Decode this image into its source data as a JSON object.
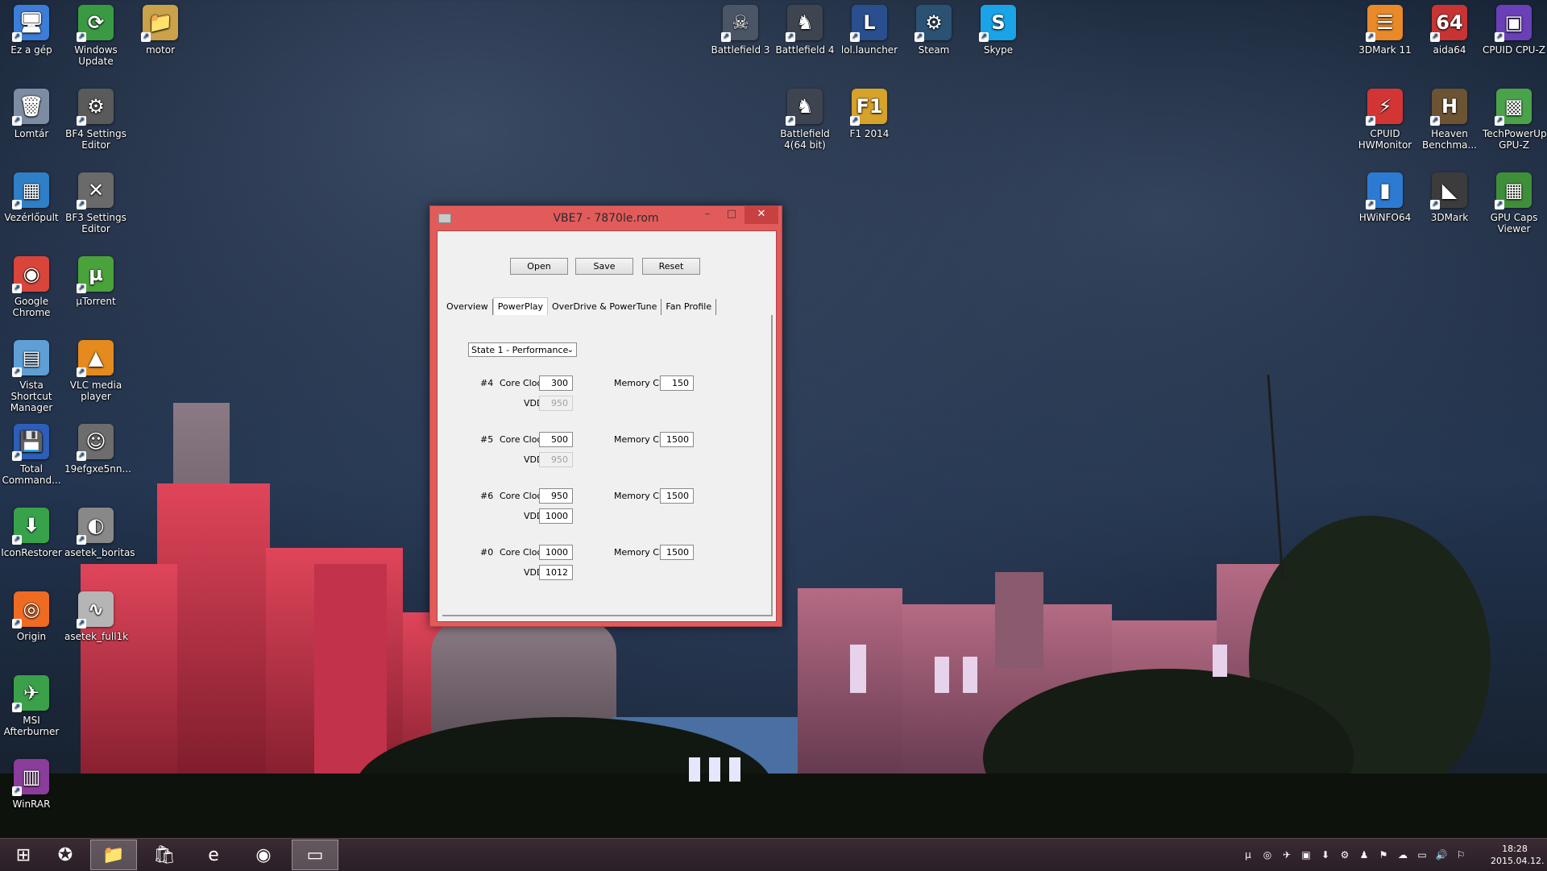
{
  "desktop_icons": [
    {
      "label": "Ez a gép",
      "icon": "computer-icon",
      "color": "#3b7dd8",
      "glyph": "🖥"
    },
    {
      "label": "Windows Update",
      "icon": "windows-update-icon",
      "color": "#3a9a43",
      "glyph": "⟳"
    },
    {
      "label": "motor",
      "icon": "folder-icon",
      "color": "#c9a24a",
      "glyph": "📁"
    },
    {
      "label": "Lomtár",
      "icon": "recycle-bin-icon",
      "color": "#7c8da3",
      "glyph": "🗑"
    },
    {
      "label": "BF4 Settings Editor",
      "icon": "gear-icon",
      "color": "#5a5a5a",
      "glyph": "⚙"
    },
    {
      "label": "Vezérlőpult",
      "icon": "control-panel-icon",
      "color": "#2f7fc7",
      "glyph": "▦"
    },
    {
      "label": "BF3 Settings Editor",
      "icon": "tools-icon",
      "color": "#6a6a6a",
      "glyph": "✕"
    },
    {
      "label": "Google Chrome",
      "icon": "chrome-icon",
      "color": "#d9453b",
      "glyph": "◉"
    },
    {
      "label": "µTorrent",
      "icon": "utorrent-icon",
      "color": "#4aa23a",
      "glyph": "µ"
    },
    {
      "label": "Vista Shortcut Manager",
      "icon": "shortcut-manager-icon",
      "color": "#5f9fd6",
      "glyph": "▤"
    },
    {
      "label": "VLC media player",
      "icon": "vlc-icon",
      "color": "#e58a1f",
      "glyph": "▲"
    },
    {
      "label": "Total Command...",
      "icon": "total-commander-icon",
      "color": "#2d5fb8",
      "glyph": "💾"
    },
    {
      "label": "19efgxe5nn...",
      "icon": "image-file-icon",
      "color": "#6d6d6d",
      "glyph": "☺"
    },
    {
      "label": "IconRestorer",
      "icon": "icon-restorer-icon",
      "color": "#38a24b",
      "glyph": "⬇"
    },
    {
      "label": "asetek_boritas",
      "icon": "image-file-icon",
      "color": "#888888",
      "glyph": "◐"
    },
    {
      "label": "Origin",
      "icon": "origin-icon",
      "color": "#f06b22",
      "glyph": "◎"
    },
    {
      "label": "asetek_full1k",
      "icon": "image-file-icon",
      "color": "#b5b5b5",
      "glyph": "∿"
    },
    {
      "label": "MSI Afterburner",
      "icon": "msi-afterburner-icon",
      "color": "#3aa04a",
      "glyph": "✈"
    },
    {
      "label": "WinRAR",
      "icon": "winrar-icon",
      "color": "#8a3d9a",
      "glyph": "▥"
    },
    {
      "label": "Battlefield 3",
      "icon": "battlefield3-icon",
      "color": "#4a5566",
      "glyph": "☠"
    },
    {
      "label": "Battlefield 4",
      "icon": "battlefield4-icon",
      "color": "#3f4550",
      "glyph": "♞"
    },
    {
      "label": "lol.launcher",
      "icon": "lol-launcher-icon",
      "color": "#2a4f8f",
      "glyph": "L"
    },
    {
      "label": "Steam",
      "icon": "steam-icon",
      "color": "#2b5273",
      "glyph": "⚙"
    },
    {
      "label": "Skype",
      "icon": "skype-icon",
      "color": "#1aa3e6",
      "glyph": "S"
    },
    {
      "label": "Battlefield 4(64 bit)",
      "icon": "battlefield4-icon",
      "color": "#3f4550",
      "glyph": "♞"
    },
    {
      "label": "F1 2014",
      "icon": "f1-2014-icon",
      "color": "#d6a22a",
      "glyph": "F1"
    },
    {
      "label": "3DMark 11",
      "icon": "3dmark11-icon",
      "color": "#e8892a",
      "glyph": "☰"
    },
    {
      "label": "aida64",
      "icon": "aida64-icon",
      "color": "#c73434",
      "glyph": "64"
    },
    {
      "label": "CPUID CPU-Z",
      "icon": "cpuz-icon",
      "color": "#6a3fb8",
      "glyph": "▣"
    },
    {
      "label": "CPUID HWMonitor",
      "icon": "hwmonitor-icon",
      "color": "#d33535",
      "glyph": "⚡"
    },
    {
      "label": "Heaven Benchma...",
      "icon": "heaven-benchmark-icon",
      "color": "#6b5334",
      "glyph": "H"
    },
    {
      "label": "TechPowerUp GPU-Z",
      "icon": "gpuz-icon",
      "color": "#4aa24a",
      "glyph": "▩"
    },
    {
      "label": "HWiNFO64",
      "icon": "hwinfo-icon",
      "color": "#2d7ad3",
      "glyph": "▮"
    },
    {
      "label": "3DMark",
      "icon": "3dmark-icon",
      "color": "#3c3c3c",
      "glyph": "◣"
    },
    {
      "label": "GPU Caps Viewer",
      "icon": "gpu-caps-icon",
      "color": "#3f8f3a",
      "glyph": "▦"
    }
  ],
  "window": {
    "title": "VBE7 - 7870le.rom",
    "controls": {
      "minimize": "–",
      "maximize": "□",
      "close": "✕"
    },
    "buttons": {
      "open": "Open",
      "save": "Save",
      "reset": "Reset"
    },
    "tabs": [
      "Overview",
      "PowerPlay",
      "OverDrive & PowerTune",
      "Fan Profile"
    ],
    "active_tab": "PowerPlay",
    "state_select": "State 1 - Performance",
    "core_label": "Core Clock",
    "memory_label": "Memory Clock",
    "vddc_label": "VDDC",
    "states": [
      {
        "id": "#4",
        "core": "300",
        "memory": "150",
        "vddc": "950",
        "vddc_disabled": true
      },
      {
        "id": "#5",
        "core": "500",
        "memory": "1500",
        "vddc": "950",
        "vddc_disabled": true
      },
      {
        "id": "#6",
        "core": "950",
        "memory": "1500",
        "vddc": "1000",
        "vddc_disabled": false
      },
      {
        "id": "#0",
        "core": "1000",
        "memory": "1500",
        "vddc": "1012",
        "vddc_disabled": false
      }
    ]
  },
  "taskbar": {
    "items": [
      {
        "name": "start-button",
        "glyph": "⊞"
      },
      {
        "name": "taskbar-app-unknown",
        "glyph": "✪"
      },
      {
        "name": "taskbar-file-explorer",
        "glyph": "📁"
      },
      {
        "name": "taskbar-store",
        "glyph": "🛍"
      },
      {
        "name": "taskbar-internet-explorer",
        "glyph": "e"
      },
      {
        "name": "taskbar-chrome",
        "glyph": "◉"
      },
      {
        "name": "taskbar-vbe7",
        "glyph": "▭"
      }
    ],
    "tray": [
      "µ",
      "◎",
      "✈",
      "▣",
      "⬇",
      "⚙",
      "♟",
      "⚑",
      "☁",
      "▭",
      "🔊",
      "⚐"
    ],
    "time": "18:28",
    "date": "2015.04.12."
  }
}
